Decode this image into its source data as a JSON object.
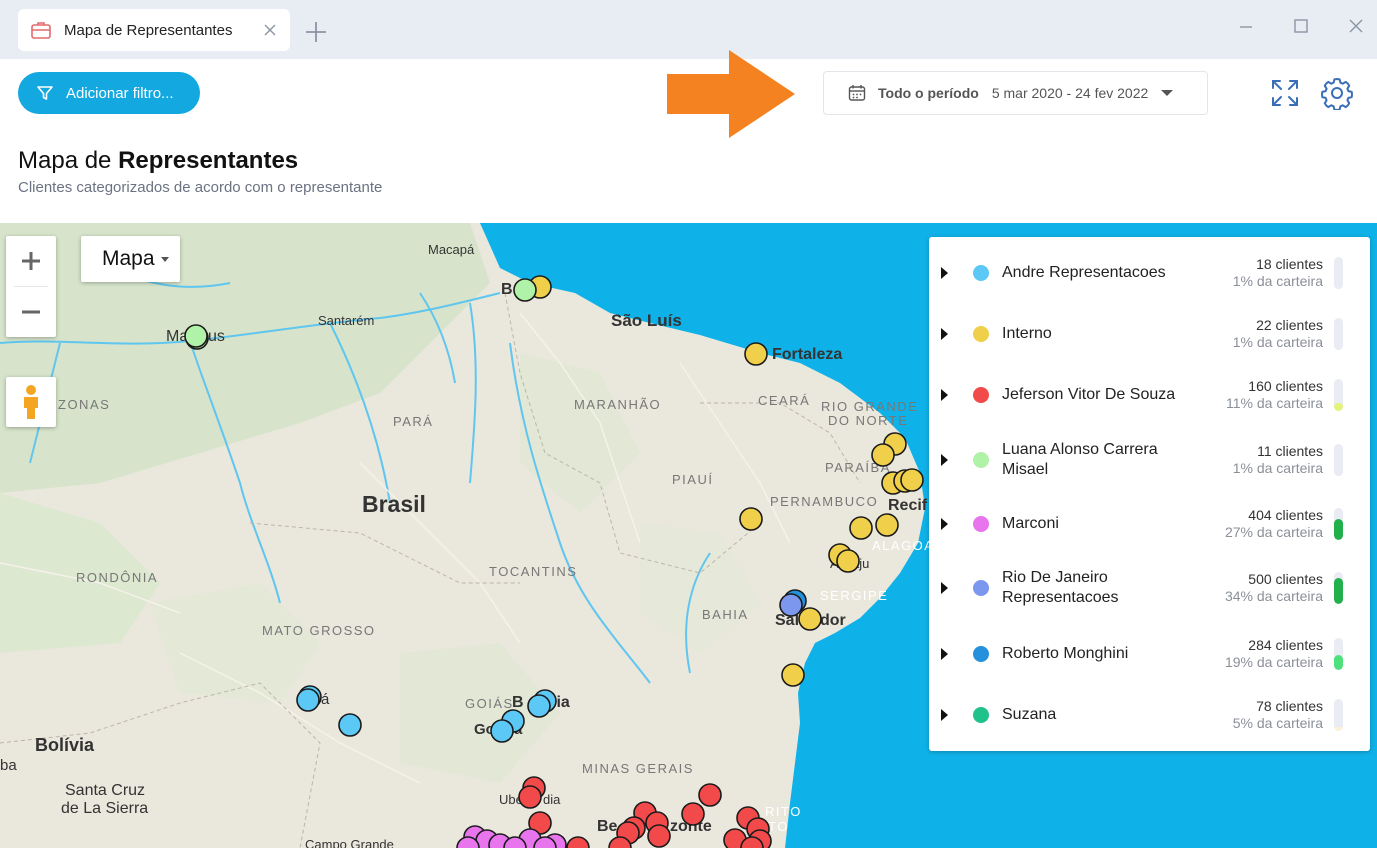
{
  "tab": {
    "title": "Mapa de Representantes"
  },
  "toolbar": {
    "filter_label": "Adicionar filtro...",
    "period_label": "Todo o período",
    "period_range": "5 mar 2020 - 24 fev 2022"
  },
  "page": {
    "title_light": "Mapa de ",
    "title_bold": "Representantes",
    "subtitle": "Clientes categorizados de acordo com o representante"
  },
  "map": {
    "type_label": "Mapa",
    "labels": {
      "macapa": "Macapá",
      "belem": "B",
      "manaus": "Ma",
      "manaus2": "us",
      "santarem": "Santarém",
      "sao_luis": "São Luís",
      "fortaleza": "Fortaleza",
      "amazonas": "ZONAS",
      "para": "PARÁ",
      "maranhao": "MARANHÃO",
      "ceara": "CEARÁ",
      "rgn1": "RIO GRANDE",
      "rgn2": "DO NORTE",
      "paraiba": "PARAÍBA",
      "piaui": "PIAUÍ",
      "pernambuco": "PERNAMBUCO",
      "recife": "Recif",
      "alagoas": "ALAGOA",
      "aracaju1": "A",
      "aracaju2": "aju",
      "brasil": "Brasil",
      "rondonia": "RONDÔNIA",
      "tocantins": "TOCANTINS",
      "sergipe": "SERGIPE",
      "bahia": "BAHIA",
      "salvador1": "Sal",
      "salvador2": "dor",
      "mato_grosso": "MATO GROSSO",
      "cuiaba": "á",
      "goias": "GOIÁS",
      "brasilia1": "B",
      "brasilia2": "lia",
      "goiania1": "Go",
      "goiania2": "a",
      "bolivia": "Bolívia",
      "ba": "ba",
      "minas": "MINAS GERAIS",
      "santa_cruz1": "Santa Cruz",
      "santa_cruz2": "de La Sierra",
      "uberlandia1": "Ube",
      "uberlandia2": "dia",
      "bh1": "Be",
      "bh2": "zonte",
      "es1": "RITO",
      "es2": "TO",
      "campo_grande": "Campo Grande"
    }
  },
  "legend": [
    {
      "name": "Andre Representacoes",
      "count": "18 clientes",
      "share": "1% da carteira",
      "color": "#5bc8f5",
      "bar": 0.01,
      "bar_color": "#e9ecf2"
    },
    {
      "name": "Interno",
      "count": "22 clientes",
      "share": "1% da carteira",
      "color": "#f0d04a",
      "bar": 0.01,
      "bar_color": "#e9ecf2"
    },
    {
      "name": "Jeferson Vitor De Souza",
      "count": "160 clientes",
      "share": "11% da carteira",
      "color": "#f24a4a",
      "bar": 0.11,
      "bar_color": "#e4f27a"
    },
    {
      "name": "Luana Alonso Carrera Misael",
      "count": "11 clientes",
      "share": "1% da carteira",
      "color": "#aff2a8",
      "bar": 0.01,
      "bar_color": "#e9ecf2"
    },
    {
      "name": "Marconi",
      "count": "404 clientes",
      "share": "27% da carteira",
      "color": "#e874ee",
      "bar": 0.27,
      "bar_color": "#22b04b"
    },
    {
      "name": "Rio De Janeiro Representacoes",
      "count": "500 clientes",
      "share": "34% da carteira",
      "color": "#7b97ee",
      "bar": 0.34,
      "bar_color": "#22b04b"
    },
    {
      "name": "Roberto Monghini",
      "count": "284 clientes",
      "share": "19% da carteira",
      "color": "#2590db",
      "bar": 0.19,
      "bar_color": "#4ee07a"
    },
    {
      "name": "Suzana",
      "count": "78 clientes",
      "share": "5% da carteira",
      "color": "#1fc28a",
      "bar": 0.05,
      "bar_color": "#fff1d8"
    }
  ]
}
